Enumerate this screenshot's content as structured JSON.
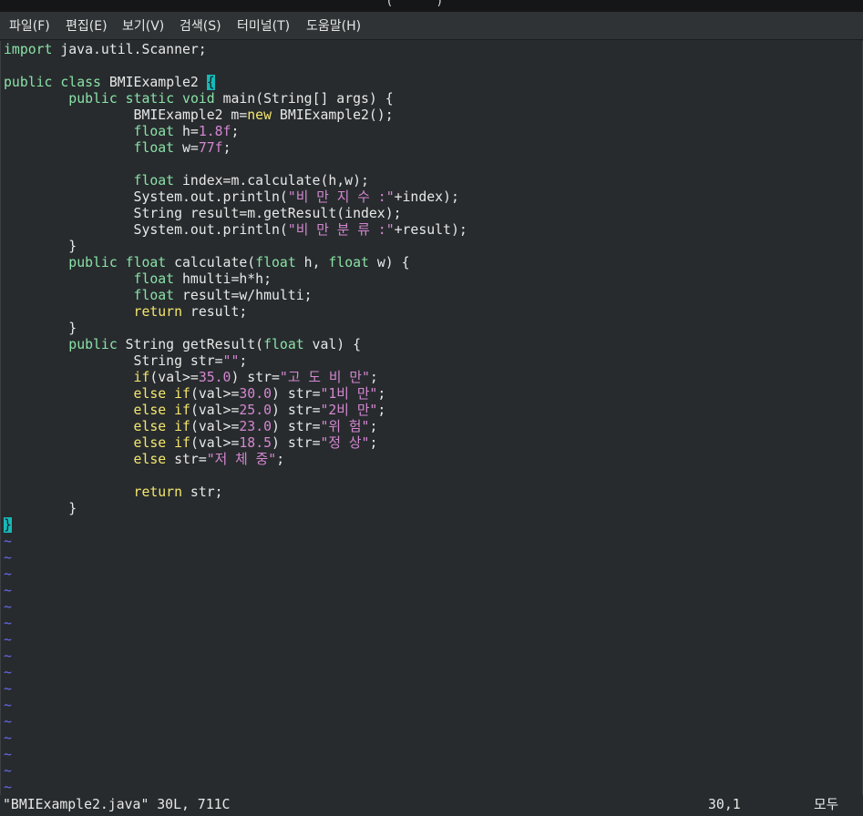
{
  "window": {
    "title_fragment": "(            )"
  },
  "menu": {
    "items": [
      {
        "label": "파일(F)"
      },
      {
        "label": "편집(E)"
      },
      {
        "label": "보기(V)"
      },
      {
        "label": "검색(S)"
      },
      {
        "label": "터미널(T)"
      },
      {
        "label": "도움말(H)"
      }
    ]
  },
  "editor": {
    "language": "java",
    "theme": {
      "background": "#272b2e",
      "text": "#e8e8e8",
      "keyword": "#8ae2a6",
      "type": "#f5e76c",
      "string_number": "#d487d0",
      "matching_brace": "#16b8b8",
      "tilde": "#6a6ae8"
    },
    "lines": [
      [
        {
          "t": "kw",
          "v": "import"
        },
        {
          "t": "",
          "v": " java.util.Scanner;"
        }
      ],
      [],
      [
        {
          "t": "kw",
          "v": "public"
        },
        {
          "t": "",
          "v": " "
        },
        {
          "t": "kw",
          "v": "class"
        },
        {
          "t": "",
          "v": " BMIExample2 "
        },
        {
          "t": "br",
          "v": "{"
        }
      ],
      [
        {
          "t": "",
          "v": "        "
        },
        {
          "t": "kw",
          "v": "public"
        },
        {
          "t": "",
          "v": " "
        },
        {
          "t": "kw",
          "v": "static"
        },
        {
          "t": "",
          "v": " "
        },
        {
          "t": "kw",
          "v": "void"
        },
        {
          "t": "",
          "v": " main(String[] args) {"
        }
      ],
      [
        {
          "t": "",
          "v": "                BMIExample2 m="
        },
        {
          "t": "ty",
          "v": "new"
        },
        {
          "t": "",
          "v": " BMIExample2();"
        }
      ],
      [
        {
          "t": "",
          "v": "                "
        },
        {
          "t": "kw",
          "v": "float"
        },
        {
          "t": "",
          "v": " h="
        },
        {
          "t": "nu",
          "v": "1.8f"
        },
        {
          "t": "",
          "v": ";"
        }
      ],
      [
        {
          "t": "",
          "v": "                "
        },
        {
          "t": "kw",
          "v": "float"
        },
        {
          "t": "",
          "v": " w="
        },
        {
          "t": "nu",
          "v": "77f"
        },
        {
          "t": "",
          "v": ";"
        }
      ],
      [],
      [
        {
          "t": "",
          "v": "                "
        },
        {
          "t": "kw",
          "v": "float"
        },
        {
          "t": "",
          "v": " index=m.calculate(h,w);"
        }
      ],
      [
        {
          "t": "",
          "v": "                System.out.println("
        },
        {
          "t": "st",
          "v": "\"비 만 지 수 :\""
        },
        {
          "t": "",
          "v": "+index);"
        }
      ],
      [
        {
          "t": "",
          "v": "                String result=m.getResult(index);"
        }
      ],
      [
        {
          "t": "",
          "v": "                System.out.println("
        },
        {
          "t": "st",
          "v": "\"비 만 분 류 :\""
        },
        {
          "t": "",
          "v": "+result);"
        }
      ],
      [
        {
          "t": "",
          "v": "        }"
        }
      ],
      [
        {
          "t": "",
          "v": "        "
        },
        {
          "t": "kw",
          "v": "public"
        },
        {
          "t": "",
          "v": " "
        },
        {
          "t": "kw",
          "v": "float"
        },
        {
          "t": "",
          "v": " calculate("
        },
        {
          "t": "kw",
          "v": "float"
        },
        {
          "t": "",
          "v": " h, "
        },
        {
          "t": "kw",
          "v": "float"
        },
        {
          "t": "",
          "v": " w) {"
        }
      ],
      [
        {
          "t": "",
          "v": "                "
        },
        {
          "t": "kw",
          "v": "float"
        },
        {
          "t": "",
          "v": " hmulti=h*h;"
        }
      ],
      [
        {
          "t": "",
          "v": "                "
        },
        {
          "t": "kw",
          "v": "float"
        },
        {
          "t": "",
          "v": " result=w/hmulti;"
        }
      ],
      [
        {
          "t": "",
          "v": "                "
        },
        {
          "t": "ty",
          "v": "return"
        },
        {
          "t": "",
          "v": " result;"
        }
      ],
      [
        {
          "t": "",
          "v": "        }"
        }
      ],
      [
        {
          "t": "",
          "v": "        "
        },
        {
          "t": "kw",
          "v": "public"
        },
        {
          "t": "",
          "v": " String getResult("
        },
        {
          "t": "kw",
          "v": "float"
        },
        {
          "t": "",
          "v": " val) {"
        }
      ],
      [
        {
          "t": "",
          "v": "                String str="
        },
        {
          "t": "st",
          "v": "\"\""
        },
        {
          "t": "",
          "v": ";"
        }
      ],
      [
        {
          "t": "",
          "v": "                "
        },
        {
          "t": "ty",
          "v": "if"
        },
        {
          "t": "",
          "v": "(val>="
        },
        {
          "t": "nu",
          "v": "35.0"
        },
        {
          "t": "",
          "v": ") str="
        },
        {
          "t": "st",
          "v": "\"고 도 비 만\""
        },
        {
          "t": "",
          "v": ";"
        }
      ],
      [
        {
          "t": "",
          "v": "                "
        },
        {
          "t": "ty",
          "v": "else"
        },
        {
          "t": "",
          "v": " "
        },
        {
          "t": "ty",
          "v": "if"
        },
        {
          "t": "",
          "v": "(val>="
        },
        {
          "t": "nu",
          "v": "30.0"
        },
        {
          "t": "",
          "v": ") str="
        },
        {
          "t": "st",
          "v": "\"1비 만\""
        },
        {
          "t": "",
          "v": ";"
        }
      ],
      [
        {
          "t": "",
          "v": "                "
        },
        {
          "t": "ty",
          "v": "else"
        },
        {
          "t": "",
          "v": " "
        },
        {
          "t": "ty",
          "v": "if"
        },
        {
          "t": "",
          "v": "(val>="
        },
        {
          "t": "nu",
          "v": "25.0"
        },
        {
          "t": "",
          "v": ") str="
        },
        {
          "t": "st",
          "v": "\"2비 만\""
        },
        {
          "t": "",
          "v": ";"
        }
      ],
      [
        {
          "t": "",
          "v": "                "
        },
        {
          "t": "ty",
          "v": "else"
        },
        {
          "t": "",
          "v": " "
        },
        {
          "t": "ty",
          "v": "if"
        },
        {
          "t": "",
          "v": "(val>="
        },
        {
          "t": "nu",
          "v": "23.0"
        },
        {
          "t": "",
          "v": ") str="
        },
        {
          "t": "st",
          "v": "\"위 험\""
        },
        {
          "t": "",
          "v": ";"
        }
      ],
      [
        {
          "t": "",
          "v": "                "
        },
        {
          "t": "ty",
          "v": "else"
        },
        {
          "t": "",
          "v": " "
        },
        {
          "t": "ty",
          "v": "if"
        },
        {
          "t": "",
          "v": "(val>="
        },
        {
          "t": "nu",
          "v": "18.5"
        },
        {
          "t": "",
          "v": ") str="
        },
        {
          "t": "st",
          "v": "\"정 상\""
        },
        {
          "t": "",
          "v": ";"
        }
      ],
      [
        {
          "t": "",
          "v": "                "
        },
        {
          "t": "ty",
          "v": "else"
        },
        {
          "t": "",
          "v": " str="
        },
        {
          "t": "st",
          "v": "\"저 체 중\""
        },
        {
          "t": "",
          "v": ";"
        }
      ],
      [],
      [
        {
          "t": "",
          "v": "                "
        },
        {
          "t": "ty",
          "v": "return"
        },
        {
          "t": "",
          "v": " str;"
        }
      ],
      [
        {
          "t": "",
          "v": "        }"
        }
      ],
      [
        {
          "t": "br",
          "v": "}"
        }
      ]
    ],
    "empty_line_marker": "~",
    "empty_line_count": 16
  },
  "status": {
    "file_info": "\"BMIExample2.java\" 30L, 711C",
    "cursor_position": "30,1",
    "scroll_position": "모두"
  }
}
